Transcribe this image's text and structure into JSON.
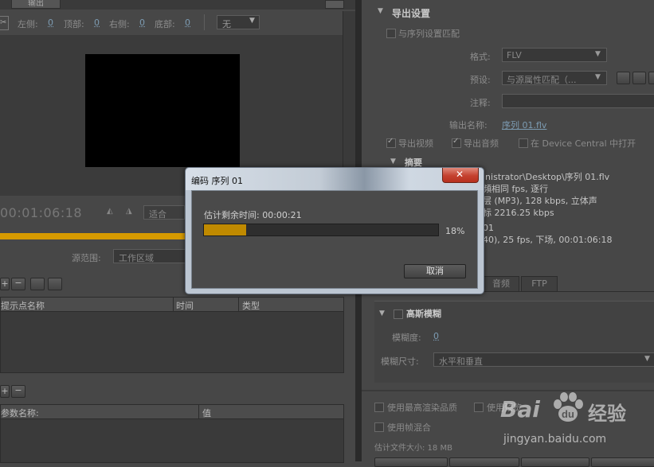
{
  "left": {
    "tab_output": "输出",
    "crop": {
      "left_label": "左侧:",
      "left_val": "0",
      "top_label": "顶部:",
      "top_val": "0",
      "right_label": "右侧:",
      "right_val": "0",
      "bottom_label": "底部:",
      "bottom_val": "0",
      "scale_value": "无"
    },
    "timecode": "00:01:06:18",
    "fit_value": "适合",
    "source_range_label": "源范围:",
    "source_range_value": "工作区域",
    "cue_table": {
      "col_name": "提示点名称",
      "col_time": "时间",
      "col_type": "类型"
    },
    "param_table": {
      "col_name": "参数名称:",
      "col_value": "值"
    }
  },
  "right": {
    "export_settings_title": "导出设置",
    "match_sequence": "与序列设置匹配",
    "format_label": "格式:",
    "format_value": "FLV",
    "preset_label": "预设:",
    "preset_value": "与源属性匹配（...",
    "comment_label": "注释:",
    "output_name_label": "输出名称:",
    "output_name_value": "序列 01.flv",
    "export_video": "导出视频",
    "export_audio": "导出音频",
    "open_in_device_central": "在 Device Central 中打开",
    "summary_title": "摘要",
    "summary_lines": [
      "inistrator\\Desktop\\序列 01.flv",
      "頻相同 fps, 逐行",
      "层 (MP3), 128 kbps, 立体声",
      "标 2216.25 kbps",
      "01",
      "40), 25 fps, 下场, 00:01:06:18"
    ],
    "tab_audio": "音频",
    "tab_ftp": "FTP",
    "gaussian_blur_title": "高斯模糊",
    "blurriness_label": "模糊度:",
    "blurriness_value": "0",
    "blur_dimensions_label": "模糊尺寸:",
    "blur_dimensions_value": "水平和垂直",
    "max_render_quality": "使用最高渲染品质",
    "use_preview": "使用预览",
    "use_frame_blending": "使用帧混合",
    "estimated_file_size": "估计文件大小: 18 MB"
  },
  "dialog": {
    "title": "编码 序列 01",
    "remaining_label": "估计剩余时间: 00:00:21",
    "progress": 0.18,
    "progress_text": "18%",
    "cancel_label": "取消"
  },
  "watermark": {
    "brand": "Bai",
    "brand_cn": "经验",
    "url": "jingyan.baidu.com"
  },
  "colors": {
    "progress_fill": "#c08a00",
    "timeline_bar": "#d69a00",
    "dialog_title_bg": "#c9d3df",
    "close_button": "#c9483c"
  }
}
